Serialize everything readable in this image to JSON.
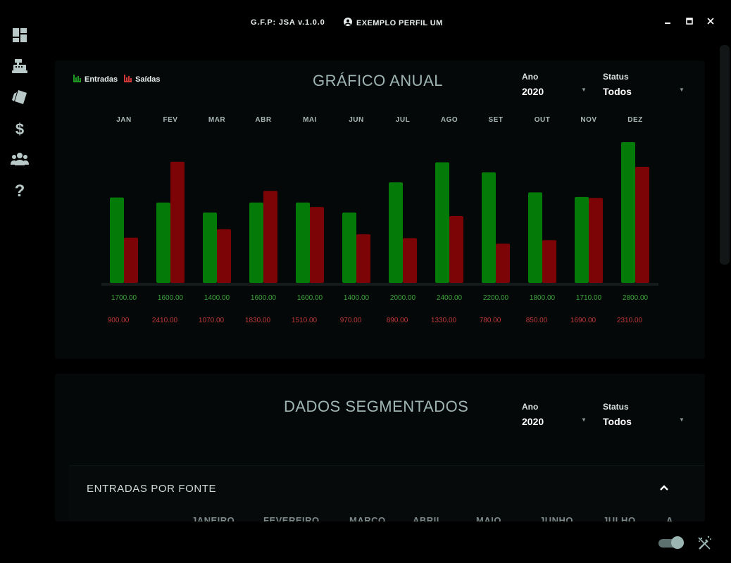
{
  "app": {
    "title": "G.F.P: JSA v.1.0.0",
    "profile_label": "EXEMPLO PERFIL UM"
  },
  "sidebar": {
    "items": [
      {
        "icon": "dashboard-icon"
      },
      {
        "icon": "cash-register-icon"
      },
      {
        "icon": "tags-icon"
      },
      {
        "icon": "dollar-icon"
      },
      {
        "icon": "users-icon"
      },
      {
        "icon": "question-icon"
      }
    ]
  },
  "window_controls": [
    "minimize-icon",
    "maximize-icon",
    "close-icon"
  ],
  "annual_chart": {
    "title": "GRÁFICO ANUAL",
    "legend": {
      "income": "Entradas",
      "expense": "Saídas"
    },
    "filters": {
      "year_label": "Ano",
      "year_value": "2020",
      "status_label": "Status",
      "status_value": "Todos"
    }
  },
  "segmented": {
    "title": "DADOS SEGMENTADOS",
    "filters": {
      "year_label": "Ano",
      "year_value": "2020",
      "status_label": "Status",
      "status_value": "Todos"
    },
    "card": {
      "title": "ENTRADAS POR FONTE",
      "columns": [
        "JANEIRO",
        "FEVEREIRO",
        "MARÇO",
        "ABRIL",
        "MAIO",
        "JUNHO",
        "JULHO",
        "A"
      ]
    }
  },
  "colors": {
    "income": "#047a08",
    "expense": "#7c0406",
    "income_text": "#3aa63a",
    "expense_text": "#c0393b",
    "accent": "#9bb5b3"
  },
  "chart_data": {
    "type": "bar",
    "categories": [
      "JAN",
      "FEV",
      "MAR",
      "ABR",
      "MAI",
      "JUN",
      "JUL",
      "AGO",
      "SET",
      "OUT",
      "NOV",
      "DEZ"
    ],
    "series": [
      {
        "name": "Entradas",
        "values": [
          1700.0,
          1600.0,
          1400.0,
          1600.0,
          1600.0,
          1400.0,
          2000.0,
          2400.0,
          2200.0,
          1800.0,
          1710.0,
          2800.0
        ],
        "labels": [
          "1700.00",
          "1600.00",
          "1400.00",
          "1600.00",
          "1600.00",
          "1400.00",
          "2000.00",
          "2400.00",
          "2200.00",
          "1800.00",
          "1710.00",
          "2800.00"
        ]
      },
      {
        "name": "Saídas",
        "values": [
          900.0,
          2410.0,
          1070.0,
          1830.0,
          1510.0,
          970.0,
          890.0,
          1330.0,
          780.0,
          850.0,
          1690.0,
          2310.0
        ],
        "labels": [
          "900.00",
          "2410.00",
          "1070.00",
          "1830.00",
          "1510.00",
          "970.00",
          "890.00",
          "1330.00",
          "780.00",
          "850.00",
          "1690.00",
          "2310.00"
        ]
      }
    ],
    "ylim": [
      0,
      2800
    ],
    "grid": false,
    "legend": "top-left"
  }
}
